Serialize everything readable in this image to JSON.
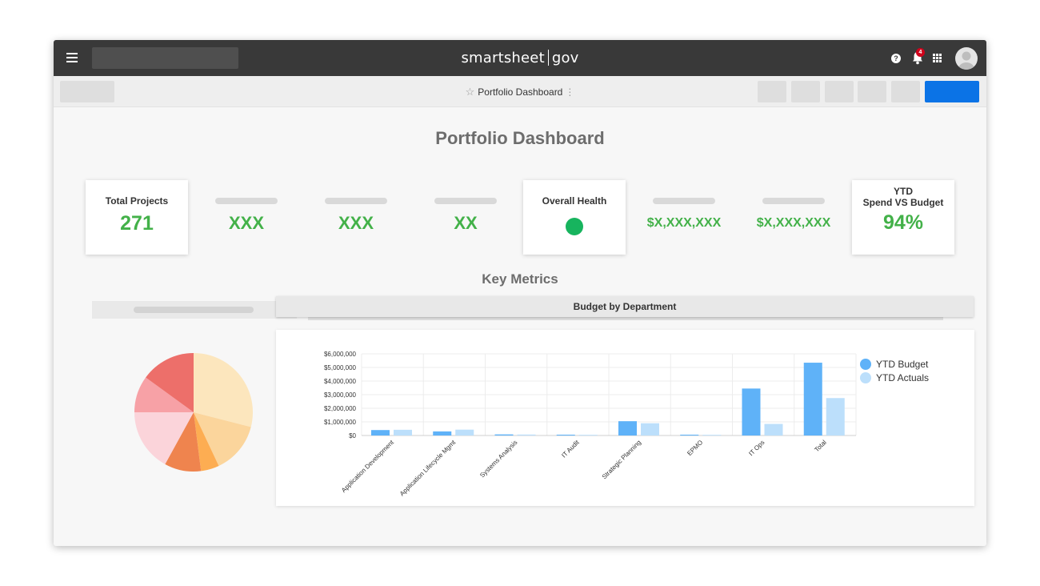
{
  "app": {
    "logo_left": "smartsheet",
    "logo_right": "gov",
    "notification_count": "4",
    "help_glyph": "?"
  },
  "icons": {
    "menu": "hamburger-menu-icon",
    "help": "help-icon",
    "notifications": "bell-icon",
    "apps": "apps-grid-icon",
    "user": "avatar-icon",
    "favorite": "star-icon",
    "more": "more-vertical-icon"
  },
  "toolbar": {
    "sheet_title": "Portfolio Dashboard",
    "star_glyph": "☆",
    "more_glyph": "⋮"
  },
  "dashboard": {
    "title": "Portfolio Dashboard",
    "key_metrics_title": "Key Metrics",
    "total_projects": {
      "label": "Total Projects",
      "value": "271"
    },
    "metric_1": "XXX",
    "metric_2": "XXX",
    "metric_3": "XX",
    "overall_health": {
      "label": "Overall Health",
      "status_color": "#17b45e"
    },
    "money_1": "$X,XXX,XXX",
    "money_2": "$X,XXX,XXX",
    "ytd": {
      "label_line1": "YTD",
      "label_line2": "Spend VS Budget",
      "value": "94%"
    }
  },
  "colors": {
    "accent_green": "#43b149",
    "primary_button": "#0b73e6",
    "topbar": "#393939"
  },
  "pie_chart": {
    "type": "pie",
    "values": [
      0.29,
      0.14,
      0.05,
      0.1,
      0.17,
      0.1,
      0.15
    ],
    "colors": [
      "#fce6bd",
      "#fbd59c",
      "#fdad52",
      "#ef844e",
      "#fbd4da",
      "#f7a1a6",
      "#ed6f6a"
    ]
  },
  "chart_data": {
    "type": "bar",
    "title": "Budget by Department",
    "categories": [
      "Application Development",
      "Application Lifecycle Mgmt",
      "Systems Analysis",
      "IT Audit",
      "Strategic Planning",
      "EPMO",
      "IT Ops",
      "Total"
    ],
    "series": [
      {
        "name": "YTD Budget",
        "color": "#5fb2f8",
        "values": [
          400000,
          300000,
          80000,
          60000,
          1050000,
          60000,
          3450000,
          5350000
        ]
      },
      {
        "name": "YTD Actuals",
        "color": "#bcdffb",
        "values": [
          420000,
          430000,
          70000,
          50000,
          900000,
          50000,
          850000,
          2750000
        ]
      }
    ],
    "y_ticks": [
      "$0",
      "$1,000,000",
      "$2,000,000",
      "$3,000,000",
      "$4,000,000",
      "$5,000,000",
      "$6,000,000"
    ],
    "ylim": [
      0,
      6000000
    ],
    "legend_position": "top-right",
    "grid": true
  }
}
